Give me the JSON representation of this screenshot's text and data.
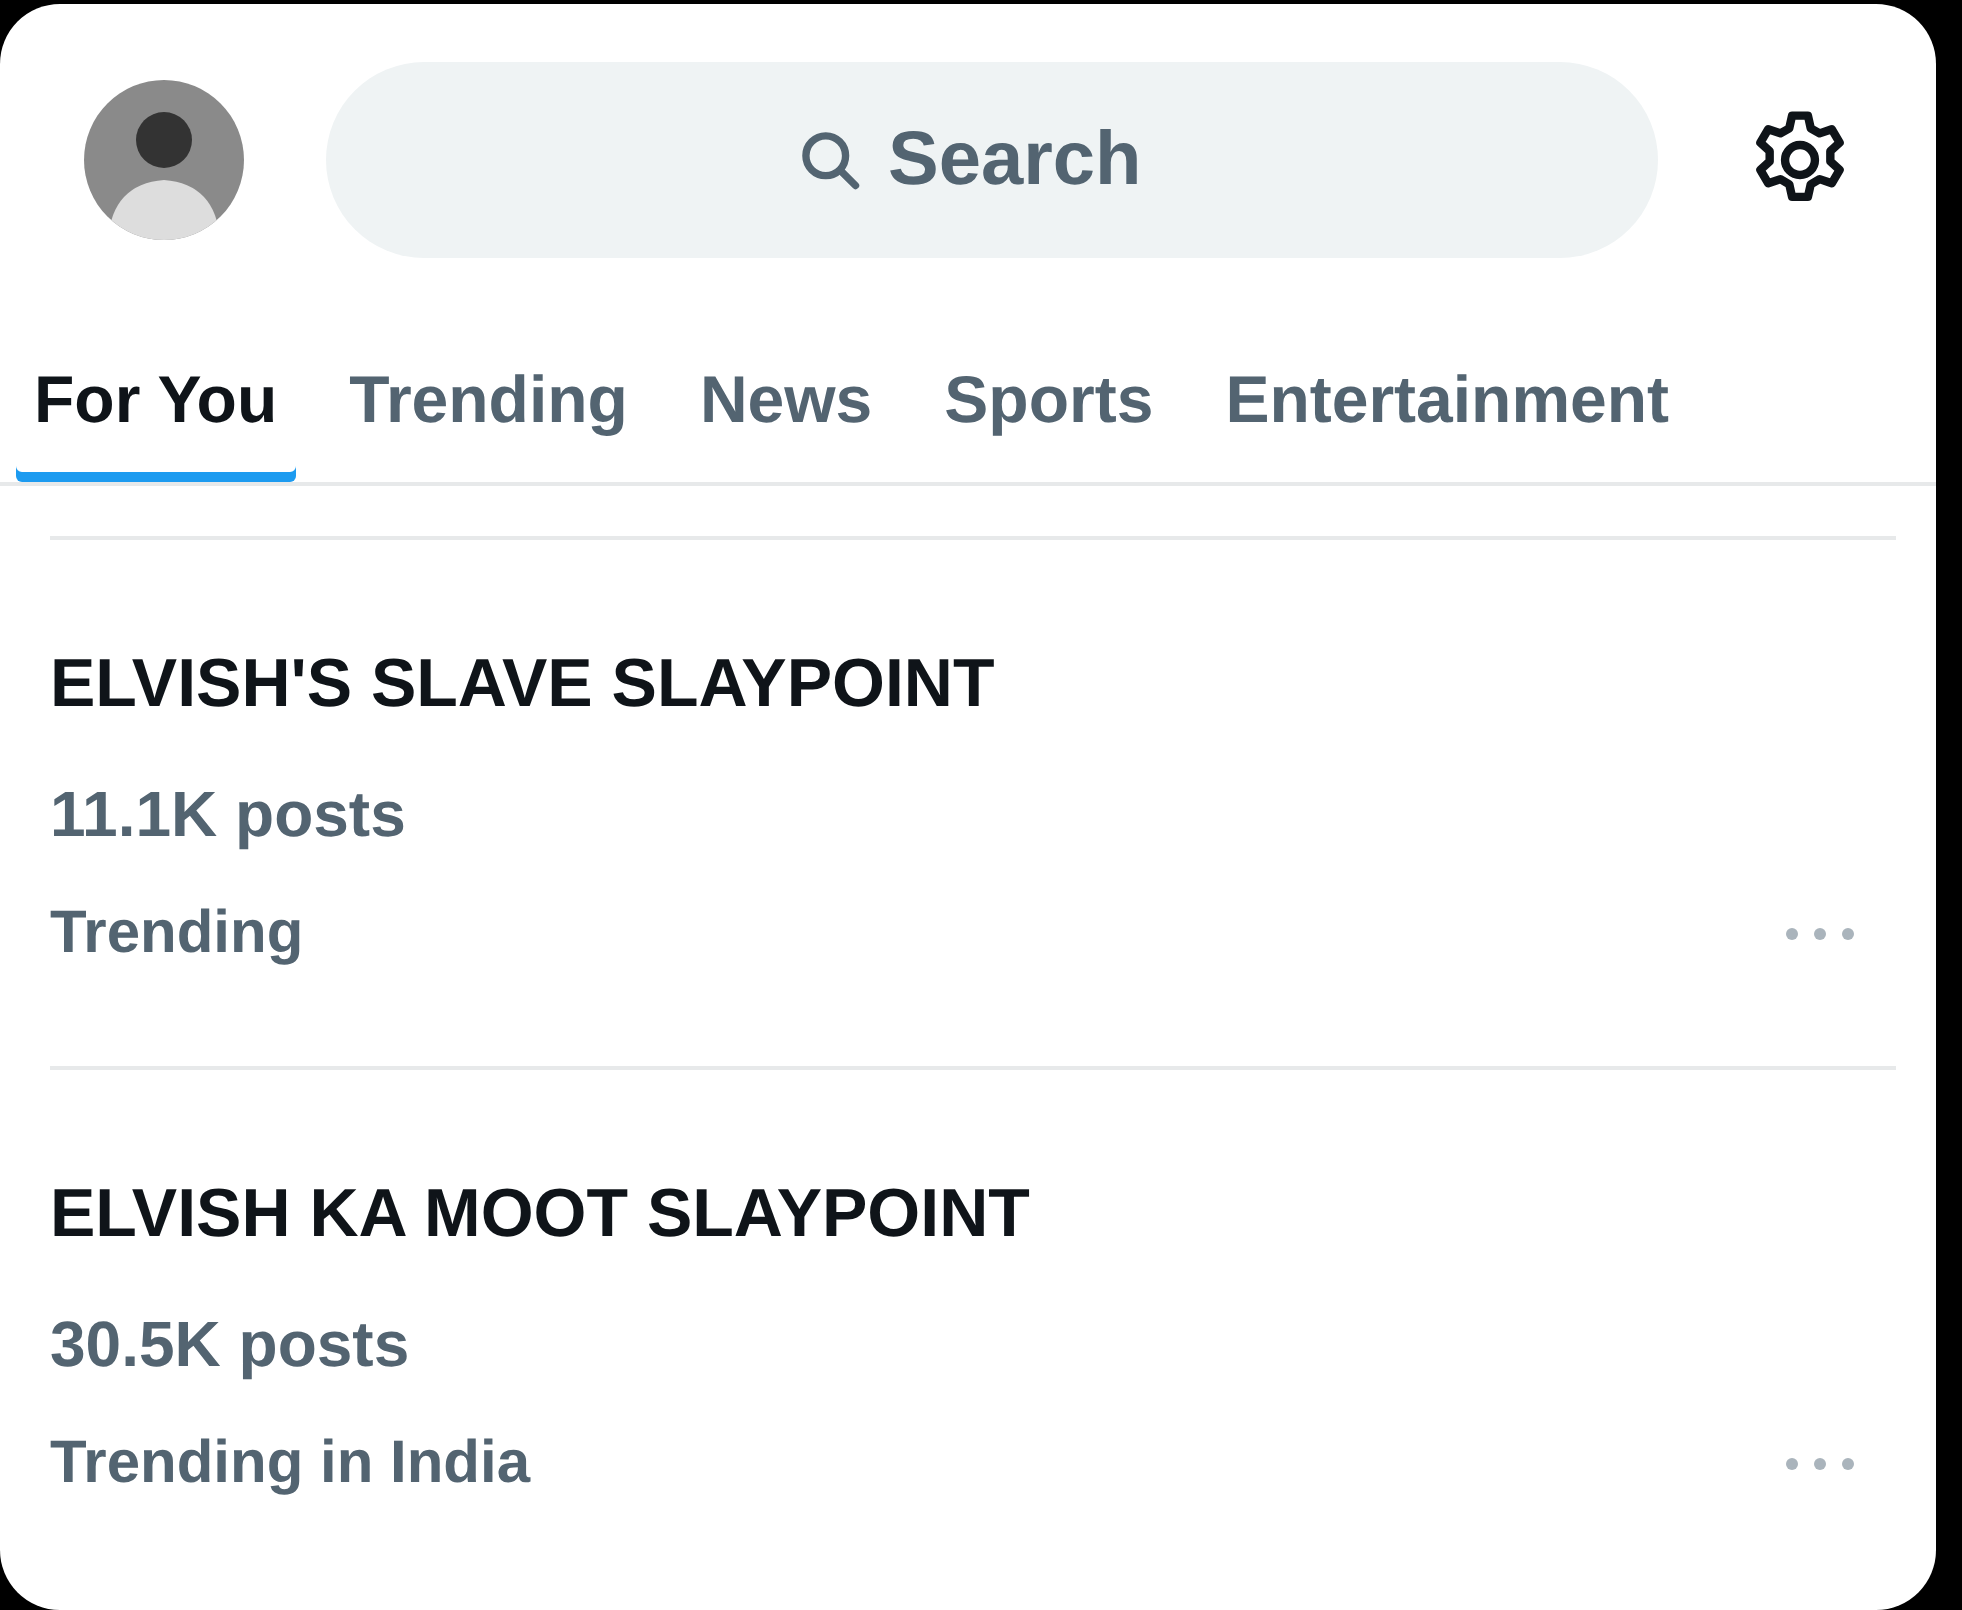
{
  "search": {
    "placeholder": "Search"
  },
  "tabs": [
    {
      "label": "For You",
      "selected": true
    },
    {
      "label": "Trending",
      "selected": false
    },
    {
      "label": "News",
      "selected": false
    },
    {
      "label": "Sports",
      "selected": false
    },
    {
      "label": "Entertainment",
      "selected": false
    }
  ],
  "trends": [
    {
      "title": "ELVISH'S SLAVE SLAYPOINT",
      "posts": "11.1K posts",
      "category": "Trending"
    },
    {
      "title": "ELVISH KA MOOT SLAYPOINT",
      "posts": "30.5K posts",
      "category": "Trending in India"
    }
  ]
}
